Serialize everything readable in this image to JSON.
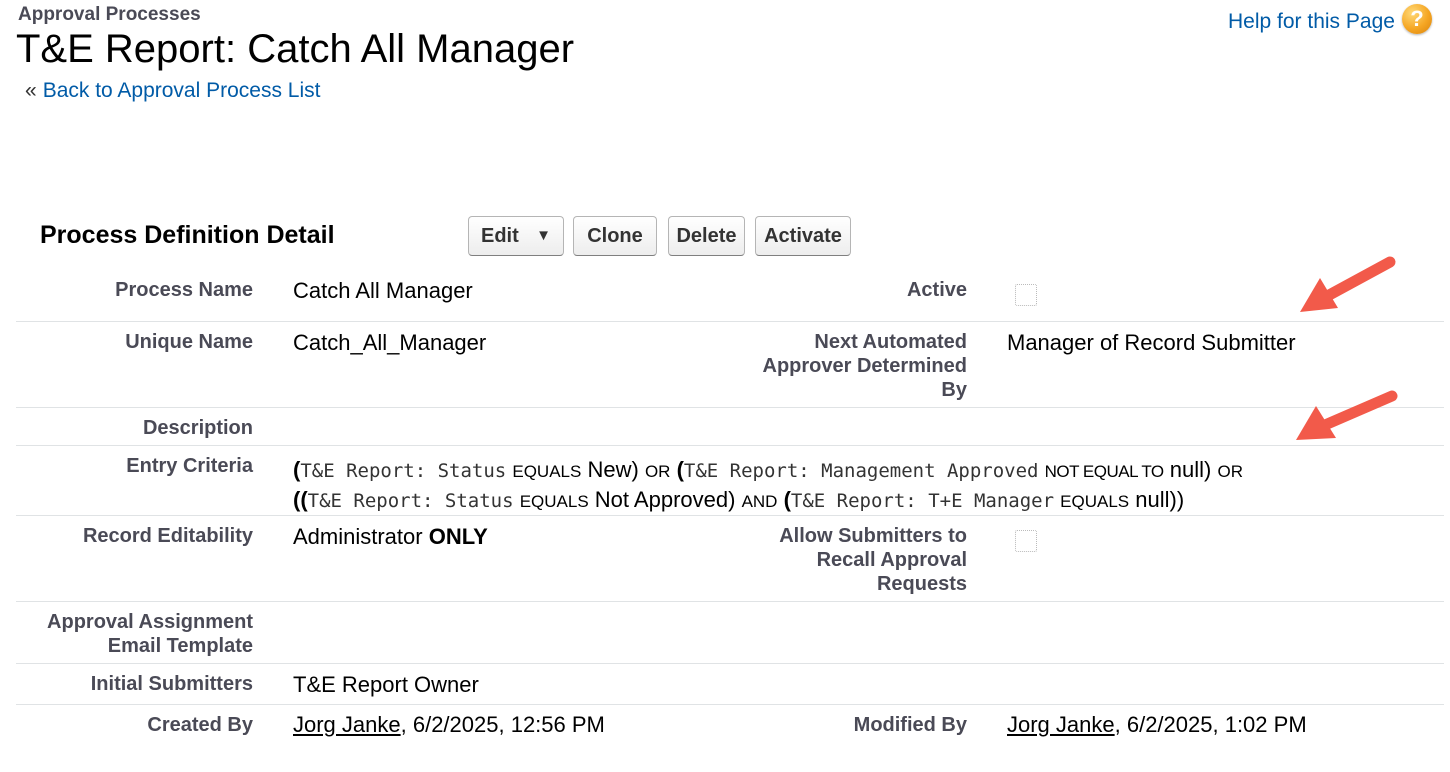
{
  "header": {
    "breadcrumb": "Approval Processes",
    "title": "T&E Report: Catch All Manager",
    "back_arrow": "«",
    "back_link": "Back to Approval Process List",
    "help_link": "Help for this Page",
    "help_icon": "?"
  },
  "section": {
    "title": "Process Definition Detail",
    "buttons": {
      "edit": "Edit",
      "edit_caret": "▼",
      "clone": "Clone",
      "delete": "Delete",
      "activate": "Activate"
    }
  },
  "fields": {
    "process_name_label": "Process Name",
    "process_name": "Catch All Manager",
    "active_label": "Active",
    "unique_name_label": "Unique Name",
    "unique_name": "Catch_All_Manager",
    "next_approver_label_1": "Next Automated",
    "next_approver_label_2": "Approver Determined",
    "next_approver_label_3": "By",
    "next_approver": "Manager of Record Submitter",
    "description_label": "Description",
    "entry_criteria_label": "Entry Criteria",
    "record_editability_label": "Record Editability",
    "record_editability_prefix": "Administrator",
    "record_editability_suffix": "ONLY",
    "allow_recall_label_1": "Allow Submitters to",
    "allow_recall_label_2": "Recall Approval",
    "allow_recall_label_3": "Requests",
    "email_template_label_1": "Approval Assignment",
    "email_template_label_2": "Email Template",
    "initial_submitters_label": "Initial Submitters",
    "initial_submitters": "T&E Report Owner",
    "created_by_label": "Created By",
    "created_by_user": "Jorg Janke",
    "created_by_date": ", 6/2/2025, 12:56 PM",
    "modified_by_label": "Modified By",
    "modified_by_user": "Jorg Janke",
    "modified_by_date": ", 6/2/2025, 1:02 PM"
  },
  "entry_criteria": {
    "line1": {
      "p1": "(",
      "f1": "T&E Report: Status",
      "op1": "EQUALS",
      "v1": "New)",
      "j1": "OR",
      "p2": "(",
      "f2": "T&E Report: Management Approved",
      "op2": "NOT EQUAL TO",
      "v2": "null)",
      "j2": "OR"
    },
    "line2": {
      "p1": "((",
      "f1": "T&E Report: Status",
      "op1": "EQUALS",
      "v1": "Not Approved)",
      "j1": "AND",
      "p2": "(",
      "f2": "T&E Report: T+E Manager",
      "op2": "EQUALS",
      "v2": "null))"
    }
  },
  "colors": {
    "link": "#015ba7",
    "label": "#4a4a56",
    "arrow": "#f25a4a",
    "help_icon": "#f5a623"
  }
}
